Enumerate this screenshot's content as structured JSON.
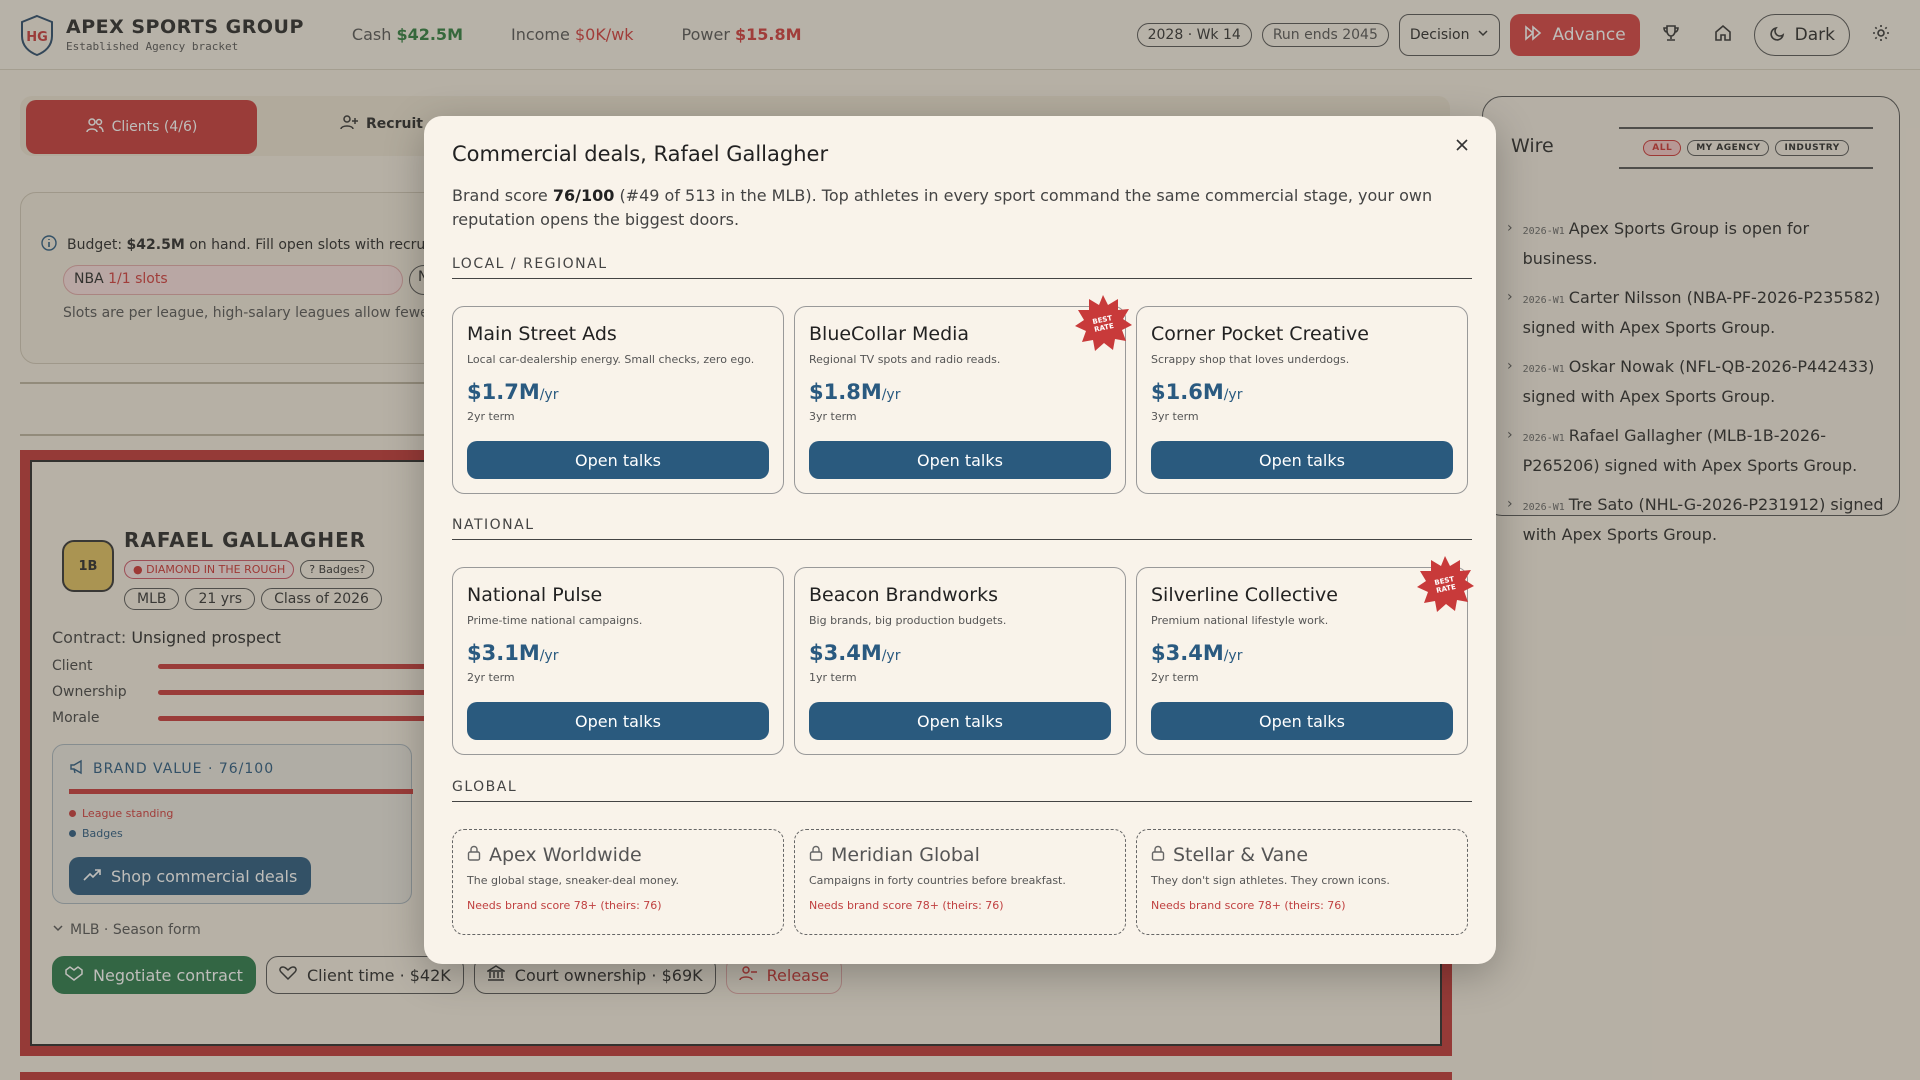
{
  "topbar": {
    "logo_text": "HG",
    "brand_name": "APEX SPORTS GROUP",
    "brand_sub": "Established Agency bracket",
    "cash_label": "Cash",
    "cash_value": "$42.5M",
    "income_label": "Income",
    "income_value": "$0K/wk",
    "power_label": "Power",
    "power_value": "$15.8M",
    "date_pill": "2028 · Wk 14",
    "run_pill": "Run ends 2045",
    "decision_label": "Decision",
    "advance_label": "Advance",
    "dark_label": "Dark"
  },
  "tabs": {
    "clients_label": "Clients (4/6)",
    "recruit_label": "Recruit"
  },
  "budget": {
    "prefix": "Budget:",
    "amount": "$42.5M",
    "text": "on hand. Fill open slots with recruits yo",
    "nba_label": "NBA",
    "nba_slots": "1/1 slots",
    "second_pill": "N",
    "note": "Slots are per league, high-salary leagues allow fewer c"
  },
  "client": {
    "position": "1B",
    "name": "RAFAEL GALLAGHER",
    "tag_primary": "DIAMOND IN THE ROUGH",
    "tag_badges": "Badges?",
    "league": "MLB",
    "age": "21 yrs",
    "class": "Class of 2026",
    "contract_label": "Contract:",
    "contract_value": "Unsigned prospect",
    "bars": [
      {
        "label": "Client"
      },
      {
        "label": "Ownership"
      },
      {
        "label": "Morale"
      }
    ],
    "brand_value_label": "BRAND VALUE · 76/100",
    "legend_1": "League standing",
    "legend_2": "Badges",
    "shop_label": "Shop commercial deals",
    "season_label": "MLB · Season form",
    "actions": {
      "negotiate": "Negotiate contract",
      "client_time": "Client time · $42K",
      "court": "Court ownership · $69K",
      "release": "Release"
    }
  },
  "wire": {
    "title": "Wire",
    "filters": [
      "ALL",
      "MY AGENCY",
      "INDUSTRY"
    ],
    "items": [
      {
        "week": "2026-W1",
        "text": "Apex Sports Group is open for business."
      },
      {
        "week": "2026-W1",
        "text": "Carter Nilsson (NBA-PF-2026-P235582) signed with Apex Sports Group."
      },
      {
        "week": "2026-W1",
        "text": "Oskar Nowak (NFL-QB-2026-P442433) signed with Apex Sports Group."
      },
      {
        "week": "2026-W1",
        "text": "Rafael Gallagher (MLB-1B-2026-P265206) signed with Apex Sports Group."
      },
      {
        "week": "2026-W1",
        "text": "Tre Sato (NHL-G-2026-P231912) signed with Apex Sports Group."
      }
    ]
  },
  "modal": {
    "title": "Commercial deals, Rafael Gallagher",
    "desc_prefix": "Brand score",
    "desc_score": "76/100",
    "desc_rest": "(#49 of 513 in the MLB). Top athletes in every sport command the same commercial stage, your own reputation opens the biggest doors.",
    "best_rate_badge": "BEST RATE",
    "sections": {
      "local": "LOCAL / REGIONAL",
      "national": "NATIONAL",
      "global": "GLOBAL"
    },
    "open_talks_label": "Open talks",
    "local_deals": [
      {
        "name": "Main Street Ads",
        "tagline": "Local car-dealership energy. Small checks, zero ego.",
        "price": "$1.7M",
        "per": "/yr",
        "term": "2yr term",
        "best": false
      },
      {
        "name": "BlueCollar Media",
        "tagline": "Regional TV spots and radio reads.",
        "price": "$1.8M",
        "per": "/yr",
        "term": "3yr term",
        "best": true
      },
      {
        "name": "Corner Pocket Creative",
        "tagline": "Scrappy shop that loves underdogs.",
        "price": "$1.6M",
        "per": "/yr",
        "term": "3yr term",
        "best": false
      }
    ],
    "national_deals": [
      {
        "name": "National Pulse",
        "tagline": "Prime-time national campaigns.",
        "price": "$3.1M",
        "per": "/yr",
        "term": "2yr term",
        "best": false
      },
      {
        "name": "Beacon Brandworks",
        "tagline": "Big brands, big production budgets.",
        "price": "$3.4M",
        "per": "/yr",
        "term": "1yr term",
        "best": false
      },
      {
        "name": "Silverline Collective",
        "tagline": "Premium national lifestyle work.",
        "price": "$3.4M",
        "per": "/yr",
        "term": "2yr term",
        "best": true
      }
    ],
    "global_deals": [
      {
        "name": "Apex Worldwide",
        "tagline": "The global stage, sneaker-deal money.",
        "requirement": "Needs brand score 78+ (theirs: 76)"
      },
      {
        "name": "Meridian Global",
        "tagline": "Campaigns in forty countries before breakfast.",
        "requirement": "Needs brand score 78+ (theirs: 76)"
      },
      {
        "name": "Stellar & Vane",
        "tagline": "They don't sign athletes. They crown icons.",
        "requirement": "Needs brand score 78+ (theirs: 76)"
      }
    ]
  },
  "colors": {
    "accent_red": "#d84141",
    "deal_blue": "#2a5a7e",
    "success_green": "#2a7a4a",
    "background": "#f3ecdf"
  }
}
